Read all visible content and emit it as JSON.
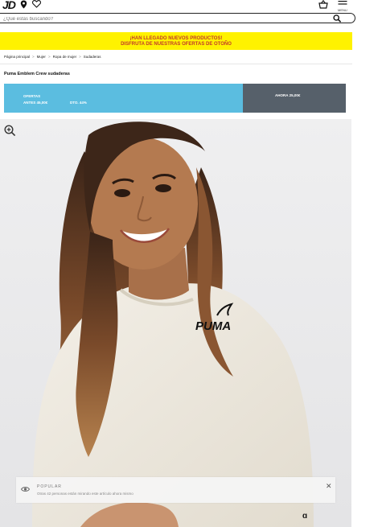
{
  "header": {
    "logo": "JD",
    "menu_label": "MENU",
    "icons": [
      "location-pin-icon",
      "heart-icon",
      "shopping-bag-icon",
      "hamburger-menu-icon"
    ]
  },
  "search": {
    "placeholder": "¿Qué estás buscando?",
    "icon": "search-icon"
  },
  "promo": {
    "line1": "¡HAN LLEGADO NUEVOS PRODUCTOS!",
    "line2": "DISFRUTA DE NUESTRAS OFERTAS DE OTOÑO",
    "background": "#fff200",
    "text_color": "#c0392b"
  },
  "breadcrumb": [
    "Página principal",
    "Mujer",
    "Ropa de mujer",
    "Sudaderas"
  ],
  "product": {
    "title": "Puma Emblem Crew sudaderas"
  },
  "offer": {
    "label": "OFERTAS",
    "before": "ANTES 45,00€",
    "discount": "DTO. 44%",
    "now": "AHORA 25,00€",
    "blue": "#5bbde0",
    "dark": "#56606a"
  },
  "image": {
    "brand_print": "PUMA"
  },
  "toast": {
    "title": "POPULAR",
    "text": "Otras 42 personas están mirando este artículo ahora mismo",
    "close": "✕"
  }
}
